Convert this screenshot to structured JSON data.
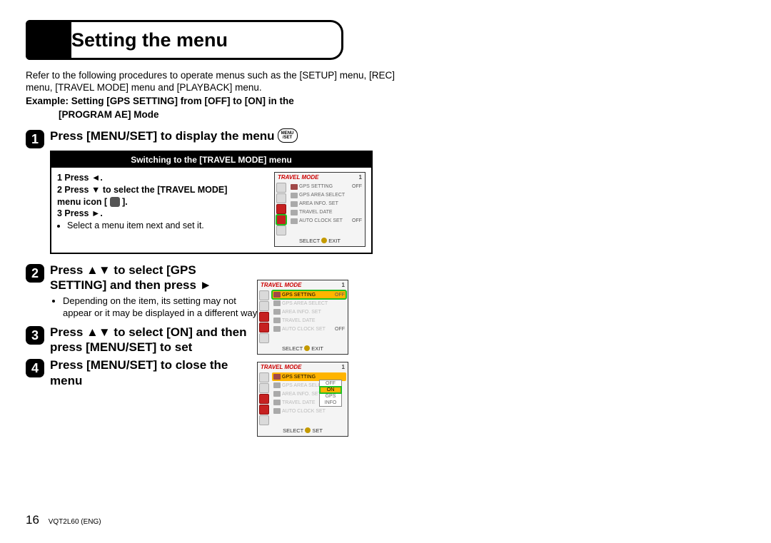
{
  "title": "Setting the menu",
  "intro": "Refer to the following procedures to operate menus such as the [SETUP] menu, [REC] menu, [TRAVEL MODE] menu and [PLAYBACK] menu.",
  "example_l1": "Example: Setting [GPS SETTING] from [OFF] to [ON] in the",
  "example_l2": "[PROGRAM AE] Mode",
  "step1": {
    "num": "1",
    "head": "Press [MENU/SET] to display the menu",
    "menuset_top": "MENU",
    "menuset_bot": "/SET"
  },
  "box": {
    "header": "Switching to the [TRAVEL MODE] menu",
    "line1a": "1 Press ",
    "line1_arrow": "◄",
    "line1b": ".",
    "line2a": "2 Press ",
    "line2_arrow": "▼",
    "line2b": " to select the [TRAVEL MODE]",
    "line3a": "   menu icon [ ",
    "line3b": " ].",
    "line4a": "3 Press ",
    "line4_arrow": "►",
    "line4b": ".",
    "bullet": "Select a menu item next and set it."
  },
  "step2": {
    "num": "2",
    "head_a": "Press ",
    "head_arrows": "▲▼",
    "head_b": " to select [GPS SETTING] and then press ",
    "head_arrow2": "►",
    "bullet": "Depending on the item, its setting may not appear or it may be displayed in a different way."
  },
  "step3": {
    "num": "3",
    "head_a": "Press ",
    "head_arrows": "▲▼",
    "head_b": " to select [ON] and then press [MENU/SET] to set"
  },
  "step4": {
    "num": "4",
    "head": "Press [MENU/SET] to close the menu"
  },
  "lcd_common": {
    "title": "TRAVEL MODE",
    "page": "1",
    "rows": {
      "gps_setting": "GPS SETTING",
      "gps_area": "GPS AREA SELECT",
      "area_info": "AREA INFO. SET",
      "travel_date": "TRAVEL DATE",
      "auto_clock": "AUTO CLOCK SET"
    },
    "vals": {
      "off": "OFF",
      "on": "ON",
      "info": "INFO"
    },
    "footer_select": "SELECT",
    "footer_exit": "EXIT",
    "footer_set": "SET"
  },
  "popup": {
    "on": "ON",
    "off": "OFF",
    "gps_icon": "GPS"
  },
  "footer": {
    "page": "16",
    "doc": "VQT2L60 (ENG)"
  }
}
